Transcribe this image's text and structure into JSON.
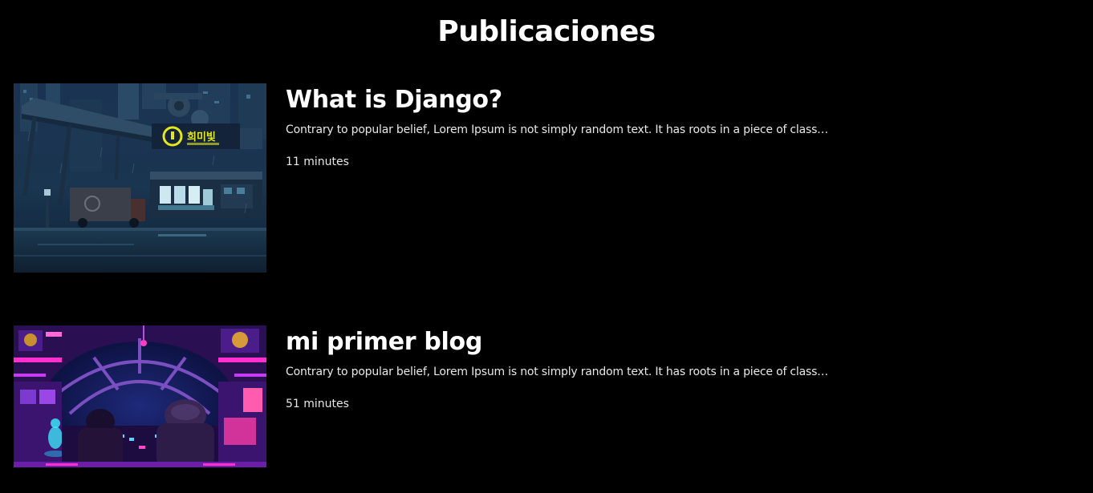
{
  "page": {
    "title": "Publicaciones"
  },
  "posts": [
    {
      "title": "What is Django?",
      "excerpt": "Contrary to popular belief, Lorem Ipsum is not simply random text. It has roots in a piece of class…",
      "read_time": "11 minutes",
      "thumbnail": "pixel-art-rainy-street-shop-image",
      "sign_text": "희미빛"
    },
    {
      "title": "mi primer blog",
      "excerpt": "Contrary to popular belief, Lorem Ipsum is not simply random text. It has roots in a piece of class…",
      "read_time": "51 minutes",
      "thumbnail": "pixel-art-spaceship-cockpit-image"
    }
  ],
  "colors": {
    "background": "#000000",
    "text": "#ffffff",
    "neon_yellow": "#e4e81a",
    "neon_magenta": "#ff2fd0",
    "neon_cyan": "#3ef0ff"
  }
}
